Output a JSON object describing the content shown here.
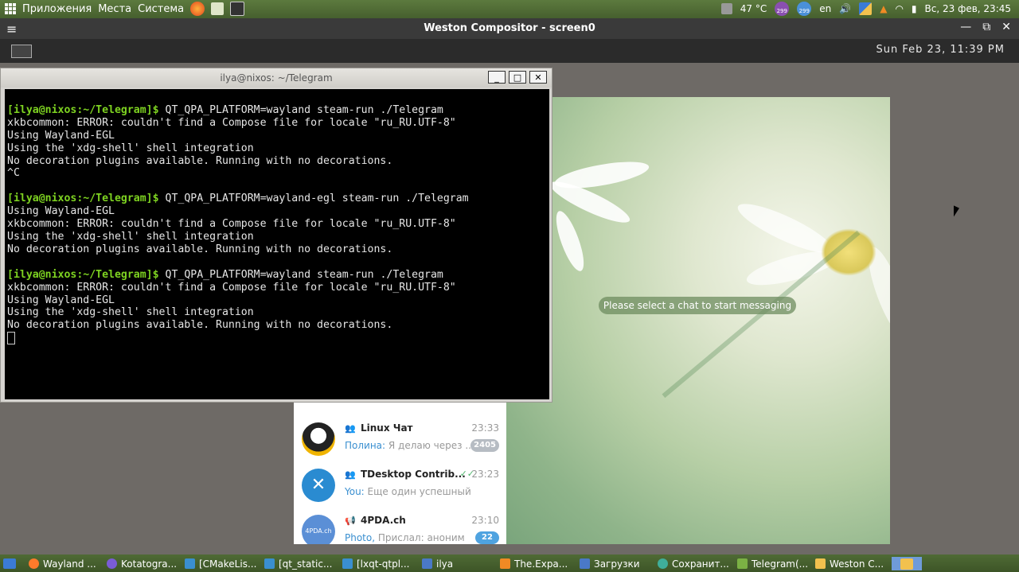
{
  "top_panel": {
    "menu_apps": "Приложения",
    "menu_places": "Места",
    "menu_system": "Система",
    "temperature": "47 °C",
    "badge1": "299",
    "badge2": "299",
    "lang": "en",
    "datetime": "Вс, 23 фев, 23:45"
  },
  "weston": {
    "title": "Weston Compositor - screen0",
    "menu_icon": "≡",
    "clock": "Sun Feb 23, 11:39 PM",
    "ctrl_min": "—",
    "ctrl_max": "⧉",
    "ctrl_close": "✕"
  },
  "terminal": {
    "title": "ilya@nixos: ~/Telegram",
    "btn_min": "_",
    "btn_max": "□",
    "btn_close": "✕",
    "prompt": "[ilya@nixos:~/Telegram]$",
    "blocks": [
      {
        "cmd": " QT_QPA_PLATFORM=wayland steam-run ./Telegram",
        "out": "xkbcommon: ERROR: couldn't find a Compose file for locale \"ru_RU.UTF-8\"\nUsing Wayland-EGL\nUsing the 'xdg-shell' shell integration\nNo decoration plugins available. Running with no decorations.\n^C"
      },
      {
        "cmd": " QT_QPA_PLATFORM=wayland-egl steam-run ./Telegram",
        "out": "Using Wayland-EGL\nxkbcommon: ERROR: couldn't find a Compose file for locale \"ru_RU.UTF-8\"\nUsing the 'xdg-shell' shell integration\nNo decoration plugins available. Running with no decorations."
      },
      {
        "cmd": " QT_QPA_PLATFORM=wayland steam-run ./Telegram",
        "out": "xkbcommon: ERROR: couldn't find a Compose file for locale \"ru_RU.UTF-8\"\nUsing Wayland-EGL\nUsing the 'xdg-shell' shell integration\nNo decoration plugins available. Running with no decorations."
      }
    ]
  },
  "telegram": {
    "empty_message": "Please select a chat to start messaging",
    "chats": [
      {
        "name": "Linux Чат",
        "time": "23:33",
        "who": "Полина:",
        "preview": " Я делаю через ...",
        "badge": "2405",
        "badge_color": "#b6bcc3",
        "avatar_icon": "tux-avatar-icon"
      },
      {
        "name": "TDesktop Contrib...",
        "time": "23:23",
        "who": "You:",
        "preview": " Еще один успешный билд...",
        "badge": "",
        "checks": "✓✓",
        "avatar_icon": "tools-avatar-icon"
      },
      {
        "name": "4PDA.ch",
        "time": "23:10",
        "who": "Photo,",
        "preview": " Прислал: аноним",
        "badge": "22",
        "badge_color": "#4fa3e0",
        "avatar_text": "4PDA.ch"
      }
    ]
  },
  "taskbar": {
    "items": [
      "Wayland ...",
      "Kotatogra...",
      "[CMakeLis...",
      "[qt_static...",
      "[lxqt-qtpl...",
      "ilya",
      "The.Expa...",
      "Загрузки",
      "Сохранит...",
      "Telegram(...",
      "Weston C..."
    ]
  }
}
